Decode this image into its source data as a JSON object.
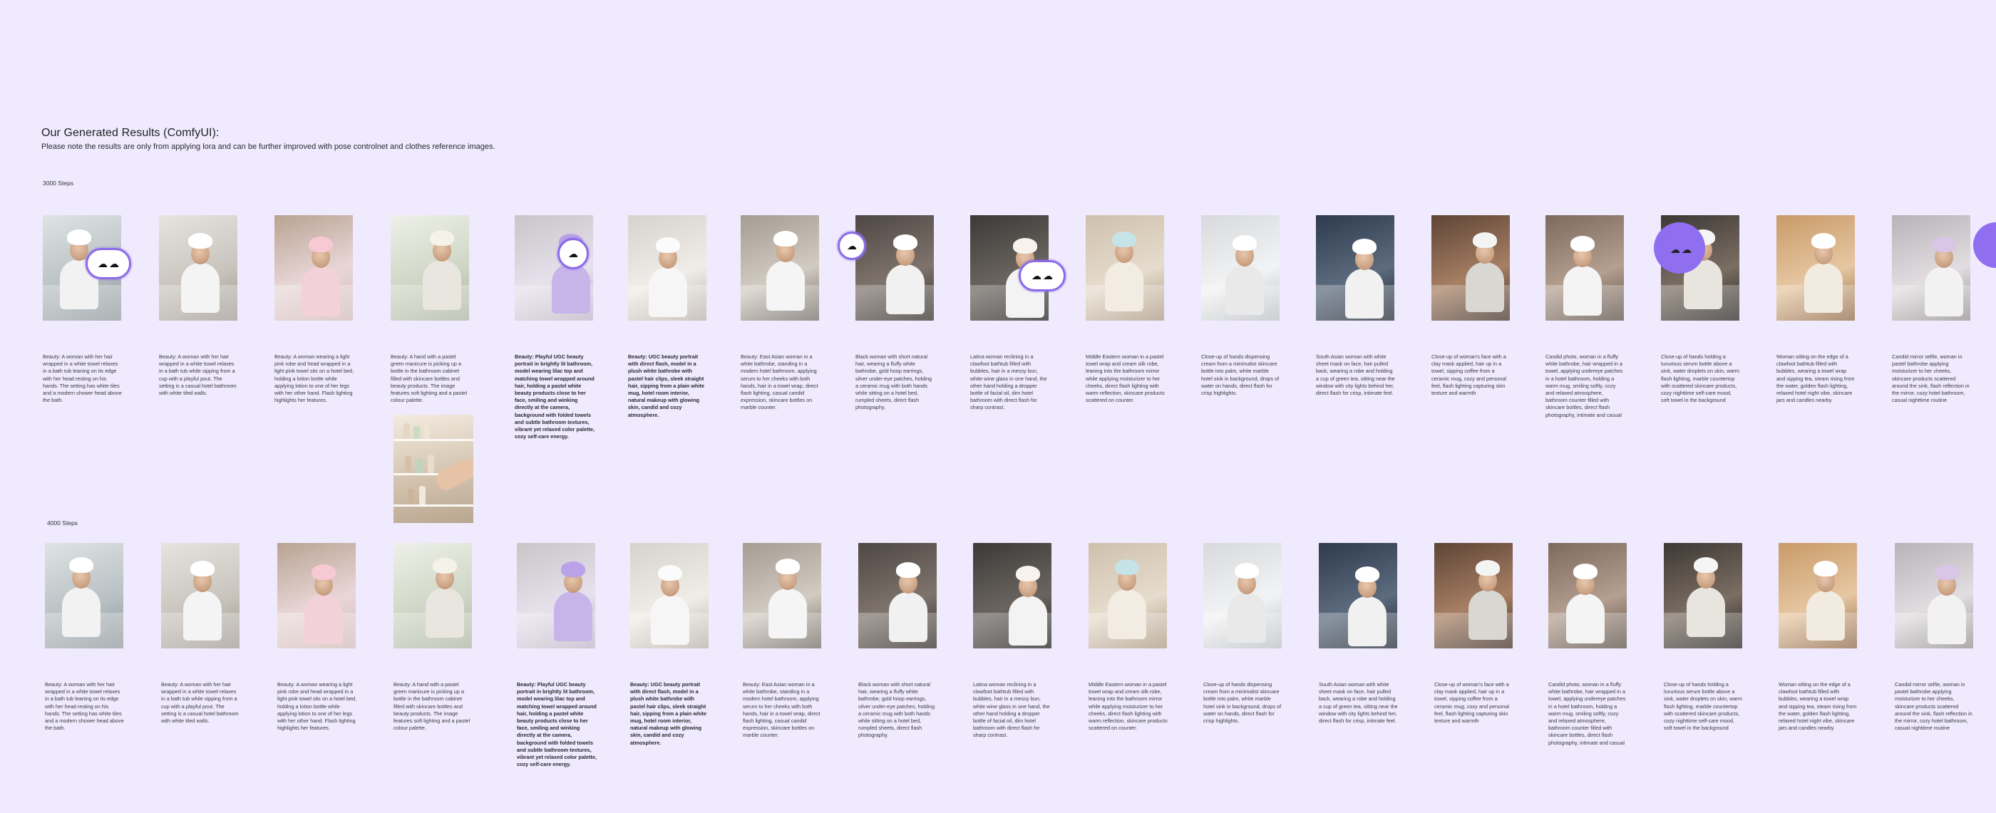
{
  "header": {
    "title": "Our Generated Results (ComfyUI):",
    "subtitle": "Please note the results are only from applying lora and can be further improved with pose controlnet and clothes reference images."
  },
  "row1_label": "3000 Steps",
  "row2_label": "4000 Steps",
  "badge_icon": "image-stack-icon",
  "accent": "#8b6ae8",
  "row1": [
    {
      "caption": "Beauty: A woman with her hair wrapped in a white towel relaxes in a bath tub leaning on its edge with her head resting on his hands. The setting has white tiles and a modern shower head above the bath.",
      "bold": false
    },
    {
      "caption": "Beauty: A woman with her hair wrapped in a white towel relaxes in a bath tub while sipping from a cup with a playful pout. The setting is a casual hotel bathroom with white tiled walls.",
      "bold": false
    },
    {
      "caption": "Beauty: A woman wearing a light pink robe and head wrapped in a light pink towel sits on a hotel bed, holding a lotion bottle while applying lotion to one of her legs with her other hand. Flash lighting highlights her features.",
      "bold": false
    },
    {
      "caption": "Beauty: A hand with a pastel green manicure is picking up a bottle in the bathroom cabinet filled with skincare bottles and beauty products. The image features soft lighting and a pastel colour palette.",
      "bold": false
    },
    {
      "caption": "Beauty: Playful UGC beauty portrait in brightly lit bathroom, model wearing lilac top and matching towel wrapped around hair, holding a pastel white beauty products close to her face, smiling and winking directly at the camera, background with folded towels and subtle bathroom textures, vibrant yet relaxed color palette, cozy self-care energy.",
      "bold": true
    },
    {
      "caption": "Beauty: UGC beauty portrait with direct flash, model in a plush white bathrobe with pastel hair clips, sleek straight hair, sipping from a plain white mug, hotel room interior, natural makeup with glowing skin, candid and cozy atmosphere.",
      "bold": true
    },
    {
      "caption": "Beauty: East Asian woman in a white bathrobe, standing in a modern hotel bathroom, applying serum to her cheeks with both hands, hair in a towel wrap, direct flash lighting, casual candid expression, skincare bottles on marble counter.",
      "bold": false
    },
    {
      "caption": "Black woman with short natural hair, wearing a fluffy white bathrobe, gold hoop earrings, silver under-eye patches, holding a ceramic mug with both hands while sitting on a hotel bed, rumpled sheets, direct flash photography.",
      "bold": false
    },
    {
      "caption": "Latina woman reclining in a clawfoot bathtub filled with bubbles, hair in a messy bun, white wine glass in one hand, the other hand holding a dropper bottle of facial oil, dim hotel bathroom with direct flash for sharp contrast.",
      "bold": false
    },
    {
      "caption": "Middle Eastern woman in a pastel towel wrap and cream silk robe, leaning into the bathroom mirror while applying moisturizer to her cheeks, direct flash lighting with warm reflection, skincare products scattered on counter.",
      "bold": false
    },
    {
      "caption": "Close-up of hands dispensing cream from a minimalist skincare bottle into palm, white marble hotel sink in background, drops of water on hands, direct flash for crisp highlights.",
      "bold": false
    },
    {
      "caption": "South Asian woman with white sheet mask on face, hair pulled back, wearing a robe and holding a cup of green tea, sitting near the window with city lights behind her, direct flash for crisp, intimate feel.",
      "bold": false
    },
    {
      "caption": "Close-up of woman's face with a clay mask applied, hair up in a towel, sipping coffee from a ceramic mug, cozy and personal feel, flash lighting capturing skin texture and warmth",
      "bold": false
    },
    {
      "caption": "Candid photo, woman in a fluffy white bathrobe, hair wrapped in a towel, applying undereye patches in a hotel bathroom, holding a warm mug, smiling softly, cozy and relaxed atmosphere, bathroom counter filled with skincare bottles, direct flash photography, intimate and casual",
      "bold": false
    },
    {
      "caption": "Close-up of hands holding a luxurious serum bottle above a sink, water droplets on skin, warm flash lighting, marble countertop with scattered skincare products, cozy nighttime self-care mood, soft towel in the background",
      "bold": false
    },
    {
      "caption": "Woman sitting on the edge of a clawfoot bathtub filled with bubbles, wearing a towel wrap and sipping tea, steam rising from the water, golden flash lighting, relaxed hotel night vibe, skincare jars and candles nearby",
      "bold": false
    },
    {
      "caption": "Candid mirror selfie, woman in pastel bathrobe applying moisturizer to her cheeks, skincare products scattered around the sink, flash reflection in the mirror, cozy hotel bathroom, casual nighttime routine",
      "bold": false
    }
  ],
  "row2": [
    {
      "caption": "Beauty: A woman with her hair wrapped in a white towel relaxes in a bath tub leaning on its edge with her head resting on his hands. The setting has white tiles and a modern shower head above the bath.",
      "bold": false
    },
    {
      "caption": "Beauty: A woman with her hair wrapped in a white towel relaxes in a bath tub while sipping from a cup with a playful pout. The setting is a casual hotel bathroom with white tiled walls.",
      "bold": false
    },
    {
      "caption": "Beauty: A woman wearing a light pink robe and head wrapped in a light pink towel sits on a hotel bed, holding a lotion bottle while applying lotion to one of her legs with her other hand. Flash lighting highlights her features.",
      "bold": false
    },
    {
      "caption": "Beauty: A hand with a pastel green manicure is picking up a bottle in the bathroom cabinet filled with skincare bottles and beauty products. The image features soft lighting and a pastel colour palette.",
      "bold": false
    },
    {
      "caption": "Beauty: Playful UGC beauty portrait in brightly lit bathroom, model wearing lilac top and matching towel wrapped around hair, holding a pastel white beauty products close to her face, smiling and winking directly at the camera, background with folded towels and subtle bathroom textures, vibrant yet relaxed color palette, cozy self-care energy.",
      "bold": true
    },
    {
      "caption": "Beauty: UGC beauty portrait with direct flash, model in a plush white bathrobe with pastel hair clips, sleek straight hair, sipping from a plain white mug, hotel room interior, natural makeup with glowing skin, candid and cozy atmosphere.",
      "bold": true
    },
    {
      "caption": "Beauty: East Asian woman in a white bathrobe, standing in a modern hotel bathroom, applying serum to her cheeks with both hands, hair in a towel wrap, direct flash lighting, casual candid expression, skincare bottles on marble counter.",
      "bold": false
    },
    {
      "caption": "Black woman with short natural hair, wearing a fluffy white bathrobe, gold hoop earrings, silver under-eye patches, holding a ceramic mug with both hands while sitting on a hotel bed, rumpled sheets, direct flash photography.",
      "bold": false
    },
    {
      "caption": "Latina woman reclining in a clawfoot bathtub filled with bubbles, hair in a messy bun, white wine glass in one hand, the other hand holding a dropper bottle of facial oil, dim hotel bathroom with direct flash for sharp contrast.",
      "bold": false
    },
    {
      "caption": "Middle Eastern woman in a pastel towel wrap and cream silk robe, leaning into the bathroom mirror while applying moisturizer to her cheeks, direct flash lighting with warm reflection, skincare products scattered on counter.",
      "bold": false
    },
    {
      "caption": "Close-up of hands dispensing cream from a minimalist skincare bottle into palm, white marble hotel sink in background, drops of water on hands, direct flash for crisp highlights.",
      "bold": false
    },
    {
      "caption": "South Asian woman with white sheet mask on face, hair pulled back, wearing a robe and holding a cup of green tea, sitting near the window with city lights behind her, direct flash for crisp, intimate feel.",
      "bold": false
    },
    {
      "caption": "Close-up of woman's face with a clay mask applied, hair up in a towel, sipping coffee from a ceramic mug, cozy and personal feel, flash lighting capturing skin texture and warmth",
      "bold": false
    },
    {
      "caption": "Candid photo, woman in a fluffy white bathrobe, hair wrapped in a towel, applying undereye patches in a hotel bathroom, holding a warm mug, smiling softly, cozy and relaxed atmosphere, bathroom counter filled with skincare bottles, direct flash photography, intimate and casual",
      "bold": false
    },
    {
      "caption": "Close-up of hands holding a luxurious serum bottle above a sink, water droplets on skin, warm flash lighting, marble countertop with scattered skincare products, cozy nighttime self-care mood, soft towel in the background",
      "bold": false
    },
    {
      "caption": "Woman sitting on the edge of a clawfoot bathtub filled with bubbles, wearing a towel wrap and sipping tea, steam rising from the water, golden flash lighting, relaxed hotel night vibe, skincare jars and candles nearby",
      "bold": false
    },
    {
      "caption": "Candid mirror selfie, woman in pastel bathrobe applying moisturizer to her cheeks, skincare products scattered around the sink, flash reflection in the mirror, cozy hotel bathroom, casual nighttime routine",
      "bold": false
    }
  ]
}
